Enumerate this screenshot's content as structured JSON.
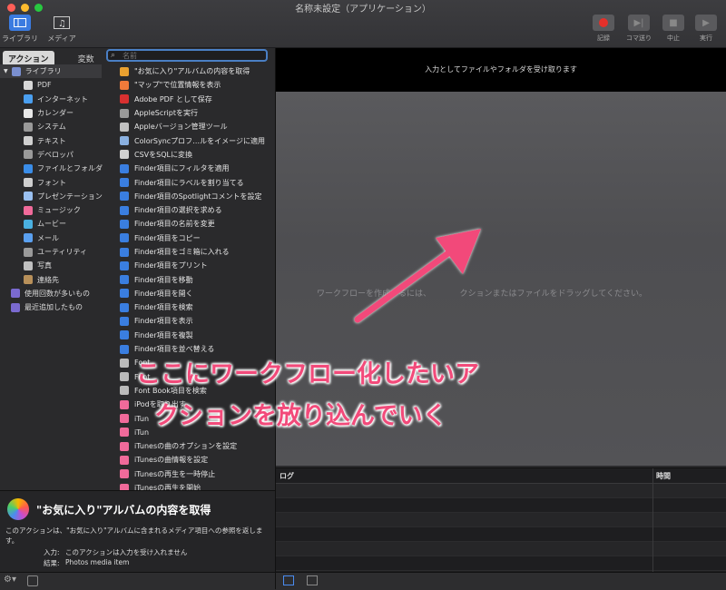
{
  "window": {
    "title": "名称未設定（アプリケーション）"
  },
  "toolbar": {
    "left": [
      {
        "label": "ライブラリ",
        "icon": "library-icon"
      },
      {
        "label": "メディア",
        "icon": "media-icon"
      }
    ],
    "right": [
      {
        "label": "記録",
        "icon": "record-icon"
      },
      {
        "label": "コマ送り",
        "icon": "step-icon"
      },
      {
        "label": "中止",
        "icon": "stop-icon"
      },
      {
        "label": "実行",
        "icon": "run-icon"
      }
    ]
  },
  "tabs": {
    "actions": "アクション",
    "variables": "変数"
  },
  "search": {
    "placeholder": "名前"
  },
  "library": [
    {
      "label": "ライブラリ",
      "color": "#7a8fd0"
    },
    {
      "label": "PDF",
      "color": "#d8d8d8"
    },
    {
      "label": "インターネット",
      "color": "#4a9ff0"
    },
    {
      "label": "カレンダー",
      "color": "#e8e8e8"
    },
    {
      "label": "システム",
      "color": "#9a9a9a"
    },
    {
      "label": "テキスト",
      "color": "#d0d0d0"
    },
    {
      "label": "デベロッパ",
      "color": "#9a9a9a"
    },
    {
      "label": "ファイルとフォルダ",
      "color": "#3a8de8"
    },
    {
      "label": "フォント",
      "color": "#cfcfcf"
    },
    {
      "label": "プレゼンテーション",
      "color": "#9ac0f0"
    },
    {
      "label": "ミュージック",
      "color": "#f06a9a"
    },
    {
      "label": "ムービー",
      "color": "#4ab0e0"
    },
    {
      "label": "メール",
      "color": "#5aa0f0"
    },
    {
      "label": "ユーティリティ",
      "color": "#9a9a9a"
    },
    {
      "label": "写真",
      "color": "#c0c0c0"
    },
    {
      "label": "連絡先",
      "color": "#b8905a"
    },
    {
      "label": "使用回数が多いもの",
      "color": "#7a6ad0"
    },
    {
      "label": "最近追加したもの",
      "color": "#7a6ad0"
    }
  ],
  "actions": [
    "\"お気に入り\"アルバムの内容を取得",
    "\"マップ\"で位置情報を表示",
    "Adobe PDF として保存",
    "AppleScriptを実行",
    "Appleバージョン管理ツール",
    "ColorSyncプロフ…ルをイメージに適用",
    "CSVをSQLに変換",
    "Finder項目にフィルタを適用",
    "Finder項目にラベルを割り当てる",
    "Finder項目のSpotlightコメントを設定",
    "Finder項目の選択を求める",
    "Finder項目の名前を変更",
    "Finder項目をコピー",
    "Finder項目をゴミ箱に入れる",
    "Finder項目をプリント",
    "Finder項目を移動",
    "Finder項目を開く",
    "Finder項目を検索",
    "Finder項目を表示",
    "Finder項目を複製",
    "Finder項目を並べ替える",
    "Font",
    "Font",
    "Font Book項目を検索",
    "iPodを取り出す",
    "iTun",
    "iTun",
    "iTunesの曲のオプションを設定",
    "iTunesの曲情報を設定",
    "iTunesの再生を一時停止",
    "iTunesの再生を開始"
  ],
  "description": {
    "title": "\"お気に入り\"アルバムの内容を取得",
    "body": "このアクションは、\"お気に入り\"アルバムに含まれるメディア項目への参照を返します。",
    "input_label": "入力:",
    "input_value": "このアクションは入力を受け入れません",
    "result_label": "結果:",
    "result_value": "Photos media item"
  },
  "workflow": {
    "header": "入力としてファイルやフォルダを受け取ります",
    "hint": "ワークフローを作成するには、　　　　クションまたはファイルをドラッグしてください。"
  },
  "log": {
    "col1": "ログ",
    "col2": "時間"
  },
  "annotation": {
    "line1": "ここにワークフロー化したいア",
    "line2": "クションを放り込んでいく",
    "color": "#f24a7a"
  }
}
